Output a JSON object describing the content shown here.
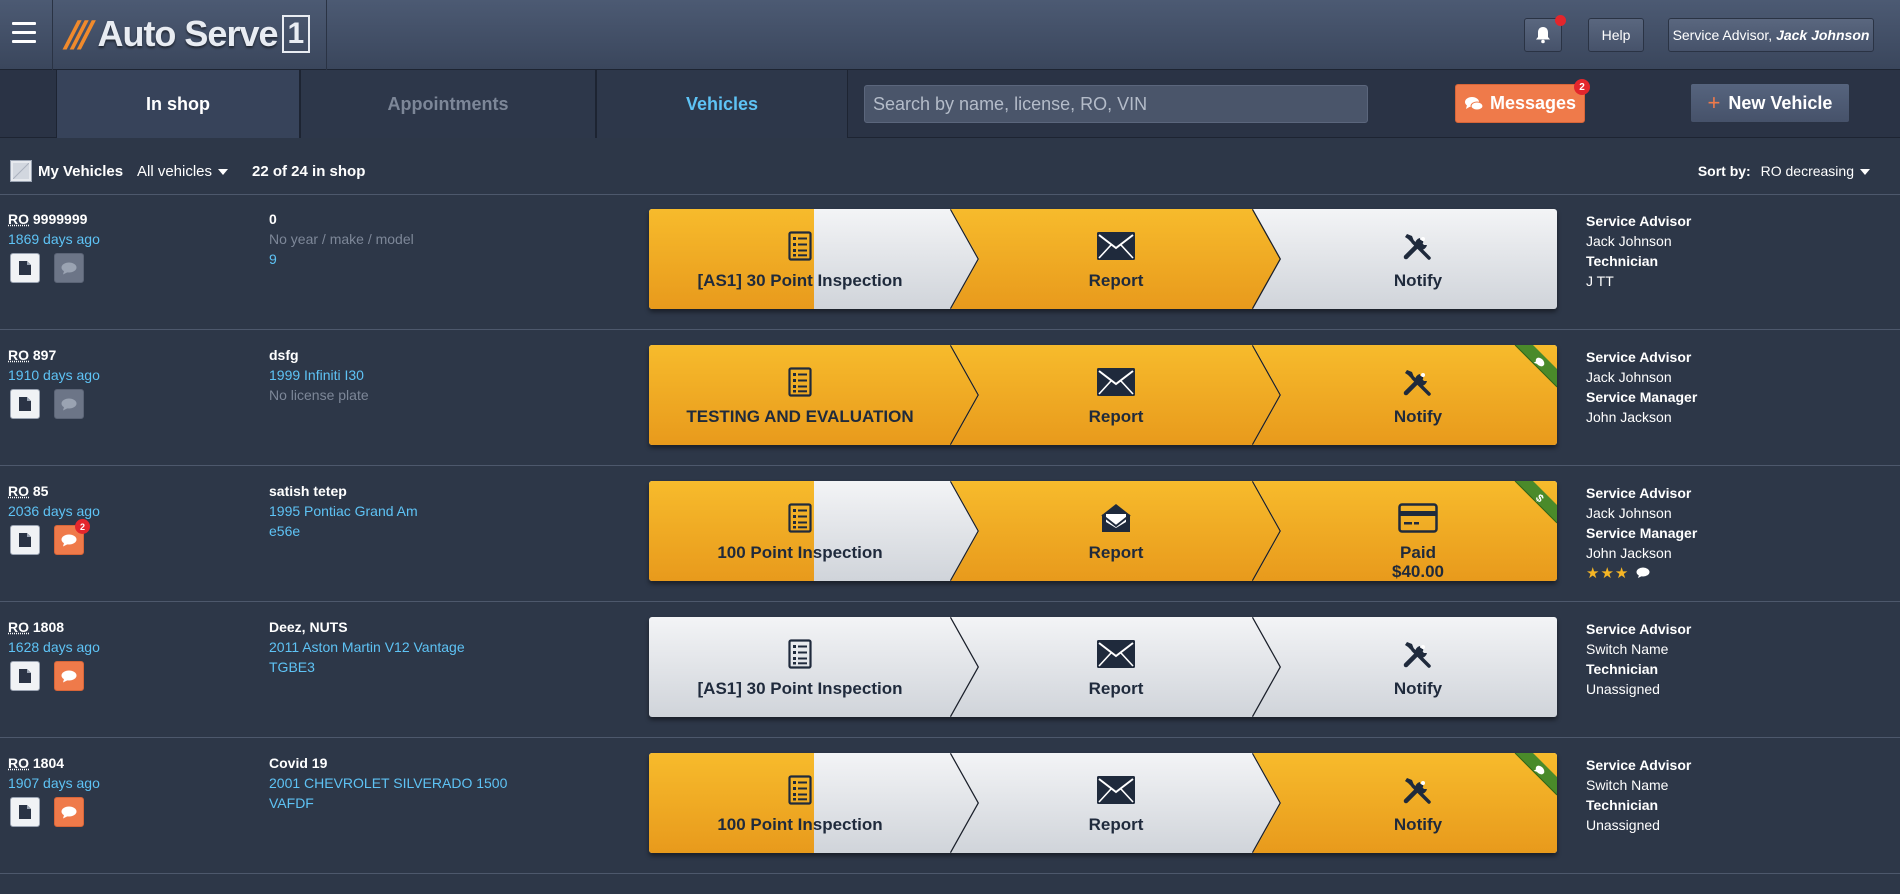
{
  "app": {
    "logo_slash": "///",
    "logo_text": "Auto Serve",
    "logo_num": "1",
    "help_label": "Help",
    "user_role": "Service Advisor,",
    "user_name": "Jack Johnson"
  },
  "nav": {
    "tabs": [
      {
        "label": "In shop"
      },
      {
        "label": "Appointments"
      },
      {
        "label": "Vehicles"
      }
    ],
    "search_placeholder": "Search by name, license, RO, VIN",
    "messages_label": "Messages",
    "messages_count": "2",
    "new_vehicle_label": "New Vehicle"
  },
  "filters": {
    "my_vehicles_label": "My Vehicles",
    "vehicle_filter": "All vehicles",
    "count_text": "22 of 24 in shop",
    "sort_label": "Sort by:",
    "sort_value": "RO decreasing"
  },
  "colors": {
    "accent_orange": "#ef7a4a",
    "step_yellow": "#f2ab24",
    "step_gray": "#dfe2e7",
    "link_blue": "#5ec3f5",
    "ribbon_green": "#4a8a2a"
  },
  "rows": [
    {
      "ro_abbr": "RO",
      "ro_num": "9999999",
      "ago": "1869 days ago",
      "customer": "0",
      "vehicle": "No year / make / model",
      "plate": "9",
      "chat_active": false,
      "chat_badge": "",
      "steps": [
        {
          "icon": "checklist-icon",
          "label": "[AS1] 30 Point Inspection",
          "label2": "",
          "progress": 0.5
        },
        {
          "icon": "envelope-icon",
          "label": "Report",
          "label2": "",
          "progress": 1
        },
        {
          "icon": "tools-icon",
          "label": "Notify",
          "label2": "",
          "progress": 0
        }
      ],
      "ribbon": "",
      "staff": [
        {
          "h": "Service Advisor",
          "v": "Jack Johnson"
        },
        {
          "h": "Technician",
          "v": "J TT"
        }
      ],
      "rating": ""
    },
    {
      "ro_abbr": "RO",
      "ro_num": "897",
      "ago": "1910 days ago",
      "customer": "dsfg",
      "vehicle": "1999 Infiniti I30",
      "plate": "No license plate",
      "chat_active": false,
      "chat_badge": "",
      "steps": [
        {
          "icon": "checklist-icon",
          "label": "TESTING AND EVALUATION",
          "label2": "",
          "progress": 1
        },
        {
          "icon": "envelope-icon",
          "label": "Report",
          "label2": "",
          "progress": 1
        },
        {
          "icon": "tools-icon",
          "label": "Notify",
          "label2": "",
          "progress": 1
        }
      ],
      "ribbon": "chat",
      "staff": [
        {
          "h": "Service Advisor",
          "v": "Jack Johnson"
        },
        {
          "h": "Service Manager",
          "v": "John Jackson"
        }
      ],
      "rating": ""
    },
    {
      "ro_abbr": "RO",
      "ro_num": "85",
      "ago": "2036 days ago",
      "customer": "satish tetep",
      "vehicle": "1995 Pontiac Grand Am",
      "plate": "e56e",
      "chat_active": true,
      "chat_badge": "2",
      "steps": [
        {
          "icon": "checklist-icon",
          "label": "100 Point Inspection",
          "label2": "",
          "progress": 0.5
        },
        {
          "icon": "open-envelope-icon",
          "label": "Report",
          "label2": "",
          "progress": 1
        },
        {
          "icon": "credit-card-icon",
          "label": "Paid",
          "label2": "$40.00",
          "progress": 1
        }
      ],
      "ribbon": "dollar",
      "staff": [
        {
          "h": "Service Advisor",
          "v": "Jack Johnson"
        },
        {
          "h": "Service Manager",
          "v": "John Jackson"
        }
      ],
      "rating": "★★★"
    },
    {
      "ro_abbr": "RO",
      "ro_num": "1808",
      "ago": "1628 days ago",
      "customer": "Deez, NUTS",
      "vehicle": "2011 Aston Martin V12 Vantage",
      "plate": "TGBE3",
      "chat_active": true,
      "chat_badge": "",
      "steps": [
        {
          "icon": "checklist-icon",
          "label": "[AS1] 30 Point Inspection",
          "label2": "",
          "progress": 0
        },
        {
          "icon": "envelope-icon",
          "label": "Report",
          "label2": "",
          "progress": 0
        },
        {
          "icon": "tools-icon",
          "label": "Notify",
          "label2": "",
          "progress": 0
        }
      ],
      "ribbon": "",
      "staff": [
        {
          "h": "Service Advisor",
          "v": "Switch Name"
        },
        {
          "h": "Technician",
          "v": "Unassigned"
        }
      ],
      "rating": ""
    },
    {
      "ro_abbr": "RO",
      "ro_num": "1804",
      "ago": "1907 days ago",
      "customer": "Covid 19",
      "vehicle": "2001 CHEVROLET SILVERADO 1500",
      "plate": "VAFDF",
      "chat_active": true,
      "chat_badge": "",
      "steps": [
        {
          "icon": "checklist-icon",
          "label": "100 Point Inspection",
          "label2": "",
          "progress": 0.5
        },
        {
          "icon": "envelope-icon",
          "label": "Report",
          "label2": "",
          "progress": 0
        },
        {
          "icon": "tools-icon",
          "label": "Notify",
          "label2": "",
          "progress": 1
        }
      ],
      "ribbon": "chat",
      "staff": [
        {
          "h": "Service Advisor",
          "v": "Switch Name"
        },
        {
          "h": "Technician",
          "v": "Unassigned"
        }
      ],
      "rating": ""
    }
  ]
}
